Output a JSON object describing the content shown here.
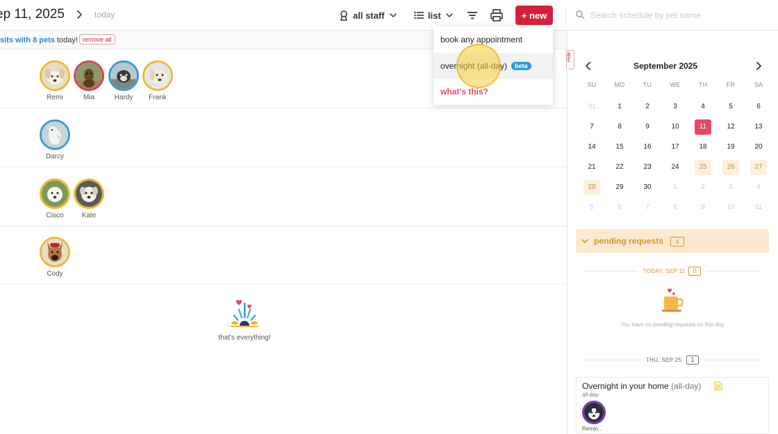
{
  "header": {
    "date_title": "ep 11, 2025",
    "today_label": "today",
    "staff_label": "all staff",
    "view_label": "list",
    "new_label": "+ new",
    "search_placeholder": "Search schedule by pet name"
  },
  "subbar": {
    "prefix": "sits with ",
    "pets_count": "8 pets",
    "suffix": " today!",
    "remove_all_label": "remove all"
  },
  "rows": [
    {
      "pets": [
        {
          "name": "Remi",
          "ring": "#f0b830"
        },
        {
          "name": "Mia",
          "ring": "#d6405a"
        },
        {
          "name": "Hardy",
          "ring": "#3a9bd0"
        },
        {
          "name": "Frank",
          "ring": "#f0b830"
        }
      ]
    },
    {
      "pets": [
        {
          "name": "Darcy",
          "ring": "#3a9bd0"
        }
      ]
    },
    {
      "pets": [
        {
          "name": "Cisco",
          "ring": "#f0b830"
        },
        {
          "name": "Kate",
          "ring": "#f0b830"
        }
      ]
    },
    {
      "pets": [
        {
          "name": "Cody",
          "ring": "#f0b830"
        }
      ]
    }
  ],
  "empty_state": {
    "text": "that's everything!"
  },
  "dropdown": {
    "items": [
      {
        "label": "book any appointment"
      },
      {
        "label": "overnight (all-day)",
        "badge": "beta"
      },
      {
        "label": "what's this?"
      }
    ]
  },
  "calendar": {
    "hide_label": "Hide",
    "month_title": "September 2025",
    "weekdays": [
      "SU",
      "MO",
      "TU",
      "WE",
      "TH",
      "FR",
      "SA"
    ],
    "weeks": [
      [
        "31",
        "1",
        "2",
        "3",
        "4",
        "5",
        "6"
      ],
      [
        "7",
        "8",
        "9",
        "10",
        "11",
        "12",
        "13"
      ],
      [
        "14",
        "15",
        "16",
        "17",
        "18",
        "19",
        "20"
      ],
      [
        "21",
        "22",
        "23",
        "24",
        "25",
        "26",
        "27"
      ],
      [
        "28",
        "29",
        "30",
        "1",
        "2",
        "3",
        "4"
      ],
      [
        "5",
        "6",
        "7",
        "8",
        "9",
        "10",
        "11"
      ]
    ],
    "selected_day": "11",
    "highlighted_days": [
      "25",
      "26",
      "27",
      "28"
    ]
  },
  "pending": {
    "label": "pending requests",
    "count": "4",
    "today_header": "TODAY, SEP 11",
    "today_count": "0",
    "no_pending_text": "You have no pending requests on this day",
    "next_header": "THU, SEP 25",
    "next_count": "1"
  },
  "appointment": {
    "title": "Overnight in your home",
    "title_suffix": " (all-day)",
    "subtitle": "all-day",
    "pet_name": "Remin..."
  },
  "colors": {
    "brand_red": "#d6203a",
    "accent_blue": "#2b8bc7",
    "pending_orange": "#d4952a",
    "ring_gold": "#f0b830"
  }
}
